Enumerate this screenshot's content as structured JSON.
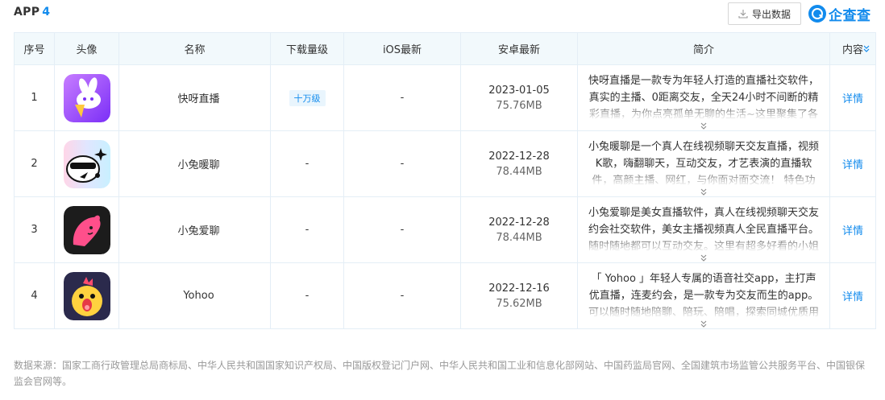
{
  "section": {
    "title": "APP",
    "count": "4"
  },
  "toolbar": {
    "export_label": "导出数据",
    "brand": "企查查"
  },
  "table": {
    "headers": {
      "index": "序号",
      "avatar": "头像",
      "name": "名称",
      "downloads": "下载量级",
      "ios": "iOS最新",
      "android": "安卓最新",
      "intro": "简介",
      "content": "内容"
    },
    "rows": [
      {
        "index": "1",
        "icon": "kuaiya-rabbit-icon",
        "name": "快呀直播",
        "downloads": "十万级",
        "ios": "-",
        "android_date": "2023-01-05",
        "android_size": "75.76MB",
        "intro": "快呀直播是一款专为年轻人打造的直播社交软件，真实的主播、0距离交友，全天24小时不间断的精彩直播，为你点亮孤单无聊的生活~这里聚集了各种高人",
        "detail": "详情"
      },
      {
        "index": "2",
        "icon": "xiaotu-nuanliao-icon",
        "name": "小兔暖聊",
        "downloads": "-",
        "ios": "-",
        "android_date": "2022-12-28",
        "android_size": "78.44MB",
        "intro": "小兔暖聊是一个真人在线视频聊天交友直播，视频K歌，嗨翻聊天，互动交友，才艺表演的直播软件，高颜主播、网红，与你面对面交流！ 特色功能：【高",
        "detail": "详情"
      },
      {
        "index": "3",
        "icon": "xiaotu-ailiao-icon",
        "name": "小兔爱聊",
        "downloads": "-",
        "ios": "-",
        "android_date": "2022-12-28",
        "android_size": "78.44MB",
        "intro": "小兔爱聊是美女直播软件，真人在线视频聊天交友约会社交软件，美女主播视频真人全民直播平台。随时随地都可以互动交友。这里有超多好看的小姐姐小哥",
        "detail": "详情"
      },
      {
        "index": "4",
        "icon": "yohoo-chick-icon",
        "name": "Yohoo",
        "downloads": "-",
        "ios": "-",
        "android_date": "2022-12-16",
        "android_size": "75.62MB",
        "intro": "「 Yohoo 」年轻人专属的语音社交app，主打声优直播，连麦约会，是一款专为交友而生的app。可以随时随地陪聊、陪玩、陪唱，探索同城优质用户，遇",
        "detail": "详情"
      }
    ]
  },
  "footer": {
    "source": "数据来源：国家工商行政管理总局商标局、中华人民共和国国家知识产权局、中国版权登记门户网、中华人民共和国工业和信息化部网站、中国药监局官网、全国建筑市场监管公共服务平台、中国银保监会官网等。"
  },
  "colors": {
    "accent": "#128bed",
    "header_bg": "#f2f9fc",
    "border": "#e4eef6",
    "muted": "#999999"
  }
}
